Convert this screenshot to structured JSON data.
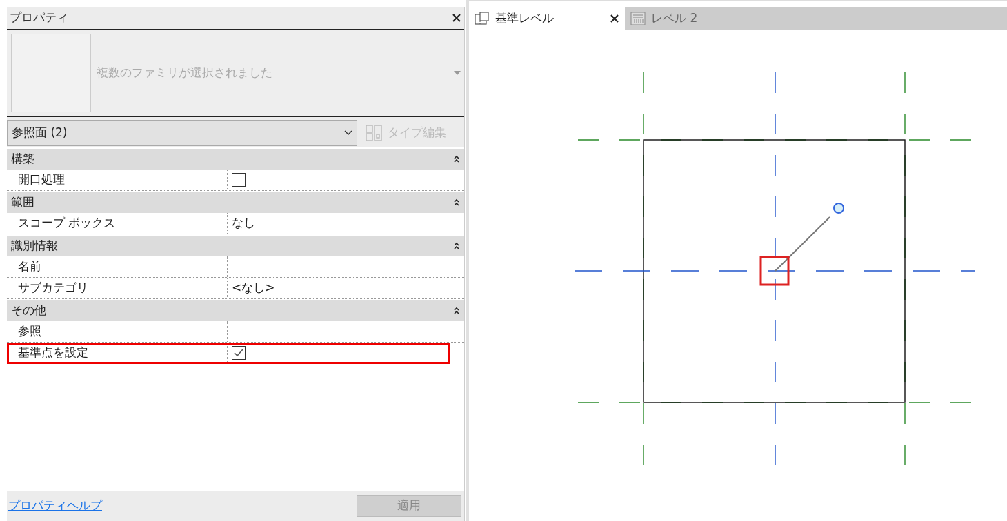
{
  "properties_panel": {
    "title": "プロパティ",
    "preview_label": "複数のファミリが選択されました",
    "type_selector": "参照面 (2)",
    "edit_type_button": {
      "label": "タイプ編集",
      "disabled": true
    },
    "groups": [
      {
        "name": "構築",
        "expanded": true,
        "rows": [
          {
            "label": "開口処理",
            "kind": "checkbox",
            "checked": false,
            "highlighted": false
          }
        ]
      },
      {
        "name": "範囲",
        "expanded": true,
        "rows": [
          {
            "label": "スコープ ボックス",
            "kind": "text",
            "value": "なし",
            "highlighted": false
          }
        ]
      },
      {
        "name": "識別情報",
        "expanded": true,
        "rows": [
          {
            "label": "名前",
            "kind": "text",
            "highlighted": false
          },
          {
            "label": "サブカテゴリ",
            "kind": "text",
            "value": "<なし>",
            "highlighted": false
          }
        ]
      },
      {
        "name": "その他",
        "expanded": true,
        "rows": [
          {
            "label": "参照",
            "kind": "text",
            "highlighted": false
          },
          {
            "label": "基準点を設定",
            "kind": "checkbox",
            "checked": true,
            "highlighted": true
          }
        ]
      }
    ],
    "help_link": "プロパティヘルプ",
    "apply_button": {
      "label": "適用",
      "disabled": true
    }
  },
  "view_tabs": [
    {
      "label": "基準レベル",
      "selected": true,
      "kind": "plan"
    },
    {
      "label": "レベル 2",
      "selected": false,
      "kind": "schedule"
    }
  ]
}
